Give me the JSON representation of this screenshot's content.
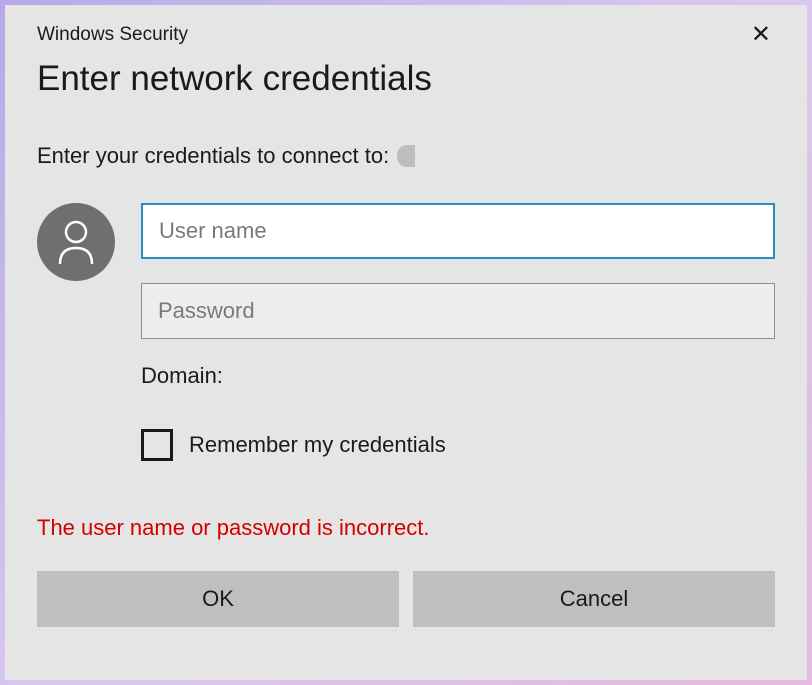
{
  "window": {
    "title": "Windows Security"
  },
  "heading": "Enter network credentials",
  "prompt": "Enter your credentials to connect to:",
  "fields": {
    "username": {
      "placeholder": "User name",
      "value": ""
    },
    "password": {
      "placeholder": "Password",
      "value": ""
    },
    "domain_label": "Domain:",
    "remember_label": "Remember my credentials",
    "remember_checked": false
  },
  "error_message": "The user name or password is incorrect.",
  "buttons": {
    "ok": "OK",
    "cancel": "Cancel"
  },
  "icons": {
    "close": "✕",
    "user": "user-icon"
  }
}
